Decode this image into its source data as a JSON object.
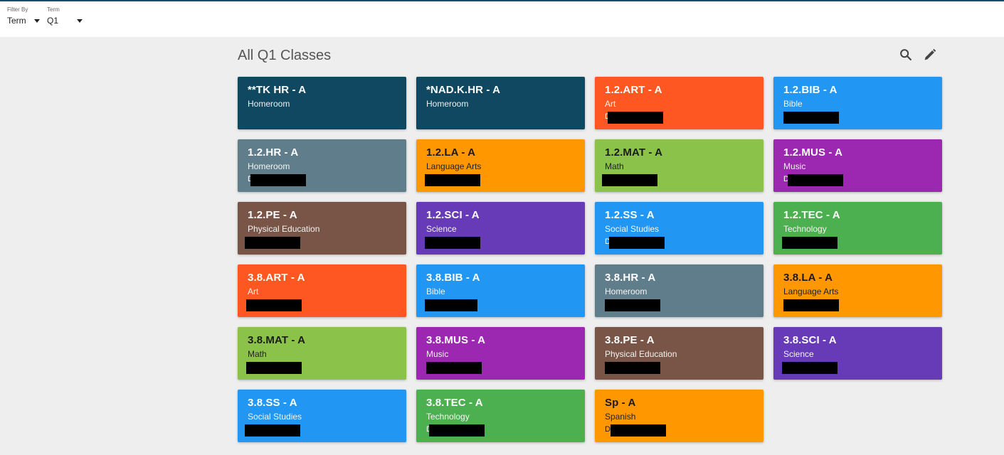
{
  "filters": {
    "filter_by": {
      "label": "Filter By",
      "value": "Term"
    },
    "term": {
      "label": "Term",
      "value": "Q1"
    }
  },
  "page": {
    "title": "All Q1 Classes",
    "icons": [
      "search-icon",
      "edit-icon"
    ]
  },
  "classes": [
    {
      "code": "**TK HR - A",
      "subject": "Homeroom",
      "teacher": "",
      "color": "#0f4860",
      "text": "light"
    },
    {
      "code": "*NAD.K.HR - A",
      "subject": "Homeroom",
      "teacher": "",
      "color": "#0f4860",
      "text": "light"
    },
    {
      "code": "1.2.ART - A",
      "subject": "Art",
      "teacher": "D",
      "color": "#ff5722",
      "text": "light"
    },
    {
      "code": "1.2.BIB - A",
      "subject": "Bible",
      "teacher": "",
      "color": "#2196f3",
      "text": "light"
    },
    {
      "code": "1.2.HR - A",
      "subject": "Homeroom",
      "teacher": "D",
      "color": "#607d8b",
      "text": "light"
    },
    {
      "code": "1.2.LA - A",
      "subject": "Language Arts",
      "teacher": "",
      "color": "#ff9800",
      "text": "dark"
    },
    {
      "code": "1.2.MAT - A",
      "subject": "Math",
      "teacher": "",
      "color": "#8bc34a",
      "text": "dark"
    },
    {
      "code": "1.2.MUS - A",
      "subject": "Music",
      "teacher": "D",
      "color": "#9c27b0",
      "text": "light"
    },
    {
      "code": "1.2.PE - A",
      "subject": "Physical Education",
      "teacher": "",
      "color": "#795548",
      "text": "light"
    },
    {
      "code": "1.2.SCI - A",
      "subject": "Science",
      "teacher": "",
      "color": "#673ab7",
      "text": "light"
    },
    {
      "code": "1.2.SS - A",
      "subject": "Social Studies",
      "teacher": "D",
      "color": "#2196f3",
      "text": "light"
    },
    {
      "code": "1.2.TEC - A",
      "subject": "Technology",
      "teacher": "",
      "color": "#4caf50",
      "text": "light"
    },
    {
      "code": "3.8.ART - A",
      "subject": "Art",
      "teacher": "",
      "color": "#ff5722",
      "text": "light"
    },
    {
      "code": "3.8.BIB - A",
      "subject": "Bible",
      "teacher": "",
      "color": "#2196f3",
      "text": "light"
    },
    {
      "code": "3.8.HR - A",
      "subject": "Homeroom",
      "teacher": "",
      "color": "#607d8b",
      "text": "light"
    },
    {
      "code": "3.8.LA - A",
      "subject": "Language Arts",
      "teacher": "",
      "color": "#ff9800",
      "text": "dark"
    },
    {
      "code": "3.8.MAT - A",
      "subject": "Math",
      "teacher": "",
      "color": "#8bc34a",
      "text": "dark"
    },
    {
      "code": "3.8.MUS - A",
      "subject": "Music",
      "teacher": "",
      "color": "#9c27b0",
      "text": "light"
    },
    {
      "code": "3.8.PE - A",
      "subject": "Physical Education",
      "teacher": "",
      "color": "#795548",
      "text": "light"
    },
    {
      "code": "3.8.SCI - A",
      "subject": "Science",
      "teacher": "",
      "color": "#673ab7",
      "text": "light"
    },
    {
      "code": "3.8.SS - A",
      "subject": "Social Studies",
      "teacher": "",
      "color": "#2196f3",
      "text": "light"
    },
    {
      "code": "3.8.TEC - A",
      "subject": "Technology",
      "teacher": "D",
      "color": "#4caf50",
      "text": "light"
    },
    {
      "code": "Sp - A",
      "subject": "Spanish",
      "teacher": "D",
      "color": "#ff9800",
      "text": "dark"
    }
  ]
}
